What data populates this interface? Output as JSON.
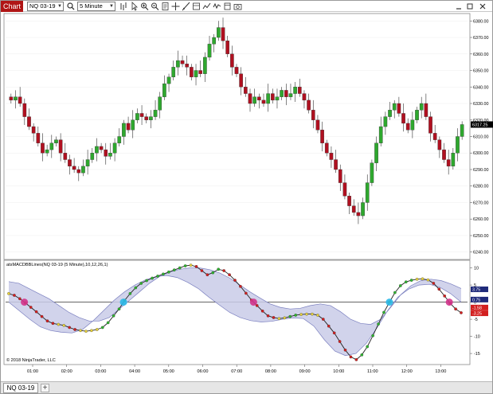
{
  "window": {
    "title_tab": "Chart",
    "instrument": "NQ 03-19",
    "interval": "5 Minute",
    "tab_label": "NQ 03-19",
    "add_tab": "+"
  },
  "toolbar_icons": [
    "search-icon",
    "bars-type-icon",
    "pointer-icon",
    "zoom-in-icon",
    "zoom-out-icon",
    "properties-icon",
    "crosshair-icon",
    "drawing-tools-icon",
    "data-box-icon",
    "strategies-icon",
    "indicators-icon",
    "templates-icon",
    "snapshot-icon"
  ],
  "colors": {
    "title_red": "#b01515",
    "candle_up": "#2ea82e",
    "candle_down": "#b01020",
    "candle_neutral": "#d8b23a",
    "band_fill": "#c9cbe8",
    "band_line": "#7a7fbf",
    "macd_up": "#2fb52f",
    "macd_down": "#d21f1f",
    "macd_mid": "#e8d23c",
    "cross_up": "#2ab8e8",
    "cross_down": "#d2348c"
  },
  "price_panel": {
    "current_price": "6317.25",
    "ticks": [
      "6380.00",
      "6370.00",
      "6360.00",
      "6350.00",
      "6340.00",
      "6330.00",
      "6320.00",
      "6310.00",
      "6300.00",
      "6290.00",
      "6280.00",
      "6270.00",
      "6260.00",
      "6250.00",
      "6240.00"
    ]
  },
  "indicator_panel": {
    "label": "atsMACDBBLines(NQ 03-19 (5 Minute),10,12,26,1)",
    "ticks": [
      "10",
      "5",
      "0",
      "-5",
      "-10",
      "-15"
    ],
    "value_boxes": [
      "3.75",
      "0.75",
      "-1.58",
      "-3.25"
    ]
  },
  "time_axis": [
    "01:00",
    "02:00",
    "03:00",
    "04:00",
    "05:00",
    "06:00",
    "07:00",
    "08:00",
    "09:00",
    "10:00",
    "11:00",
    "12:00",
    "13:00"
  ],
  "copyright": "© 2018 NinjaTrader, LLC",
  "chart_data": [
    {
      "type": "candlestick",
      "title": "NQ 03-19 (5 Minute)",
      "ylim": [
        6236,
        6384
      ],
      "close_series": [
        6332,
        6334,
        6330,
        6322,
        6316,
        6312,
        6306,
        6300,
        6302,
        6306,
        6308,
        6300,
        6296,
        6292,
        6290,
        6288,
        6292,
        6296,
        6300,
        6304,
        6302,
        6298,
        6300,
        6306,
        6310,
        6318,
        6314,
        6320,
        6324,
        6322,
        6320,
        6322,
        6326,
        6334,
        6342,
        6346,
        6352,
        6356,
        6354,
        6352,
        6346,
        6350,
        6348,
        6358,
        6366,
        6370,
        6376,
        6368,
        6360,
        6352,
        6348,
        6340,
        6336,
        6330,
        6334,
        6332,
        6330,
        6336,
        6332,
        6334,
        6338,
        6334,
        6336,
        6340,
        6336,
        6332,
        6326,
        6320,
        6314,
        6306,
        6300,
        6296,
        6290,
        6282,
        6274,
        6268,
        6264,
        6262,
        6270,
        6282,
        6294,
        6306,
        6316,
        6322,
        6326,
        6330,
        6324,
        6318,
        6314,
        6320,
        6326,
        6330,
        6322,
        6312,
        6308,
        6302,
        6296,
        6292,
        6300,
        6310,
        6317.25
      ]
    },
    {
      "type": "line",
      "title": "atsMACDBBLines(NQ 03-19 (5 Minute),10,12,26,1)",
      "ylim": [
        -18,
        12
      ],
      "series": [
        {
          "name": "MACD",
          "values": [
            2.5,
            2.0,
            1.0,
            -0.2,
            -1.5,
            -2.8,
            -4.2,
            -5.5,
            -6.2,
            -6.5,
            -6.8,
            -7.4,
            -8.0,
            -8.3,
            -8.5,
            -8.3,
            -8.0,
            -7.4,
            -6.0,
            -4.0,
            -2.0,
            0.5,
            2.5,
            4.2,
            5.5,
            6.3,
            7.0,
            7.6,
            8.2,
            8.8,
            9.4,
            10.0,
            10.6,
            10.8,
            10.4,
            9.2,
            8.0,
            8.6,
            9.6,
            9.2,
            8.0,
            6.4,
            4.6,
            2.6,
            0.6,
            -1.0,
            -2.6,
            -4.0,
            -4.5,
            -4.8,
            -4.6,
            -4.2,
            -3.8,
            -3.6,
            -3.5,
            -3.5,
            -3.8,
            -5.0,
            -7.0,
            -9.0,
            -11.5,
            -14.0,
            -16.0,
            -16.8,
            -15.4,
            -13.0,
            -9.8,
            -6.4,
            -3.0,
            0.0,
            2.8,
            4.8,
            5.9,
            6.4,
            6.7,
            6.8,
            6.5,
            5.5,
            3.8,
            1.8,
            -0.3,
            -2.0,
            -3.1
          ]
        },
        {
          "name": "Upper Band",
          "values": [
            6.0,
            5.5,
            4.0,
            2.5,
            1.0,
            -1.0,
            -3.0,
            -4.5,
            -5.5,
            -5.5,
            -4.5,
            -2.0,
            0.5,
            3.0,
            5.5,
            7.5,
            8.8,
            9.6,
            10.0,
            10.0,
            9.5,
            8.5,
            7.0,
            5.0,
            3.0,
            1.2,
            -0.5,
            -1.5,
            -2.0,
            -1.8,
            -1.0,
            -0.5,
            -1.0,
            -2.8,
            -5.0,
            -6.2,
            -6.5,
            -5.0,
            -1.5,
            2.2,
            4.8,
            6.3,
            6.7,
            6.3,
            5.3,
            4.0
          ]
        },
        {
          "name": "Lower Band",
          "values": [
            0.0,
            -2.5,
            -5.0,
            -7.2,
            -8.3,
            -8.8,
            -9.0,
            -8.0,
            -5.5,
            -2.5,
            0.5,
            3.0,
            5.0,
            6.5,
            7.5,
            7.8,
            7.2,
            5.8,
            4.0,
            1.5,
            -0.8,
            -3.0,
            -4.5,
            -5.4,
            -5.8,
            -5.6,
            -5.0,
            -4.6,
            -4.8,
            -7.0,
            -11.0,
            -14.3,
            -15.6,
            -15.0,
            -12.0,
            -7.5,
            -2.5,
            1.5,
            3.8,
            5.0,
            5.2,
            4.3,
            2.5,
            0.0
          ]
        }
      ]
    }
  ]
}
